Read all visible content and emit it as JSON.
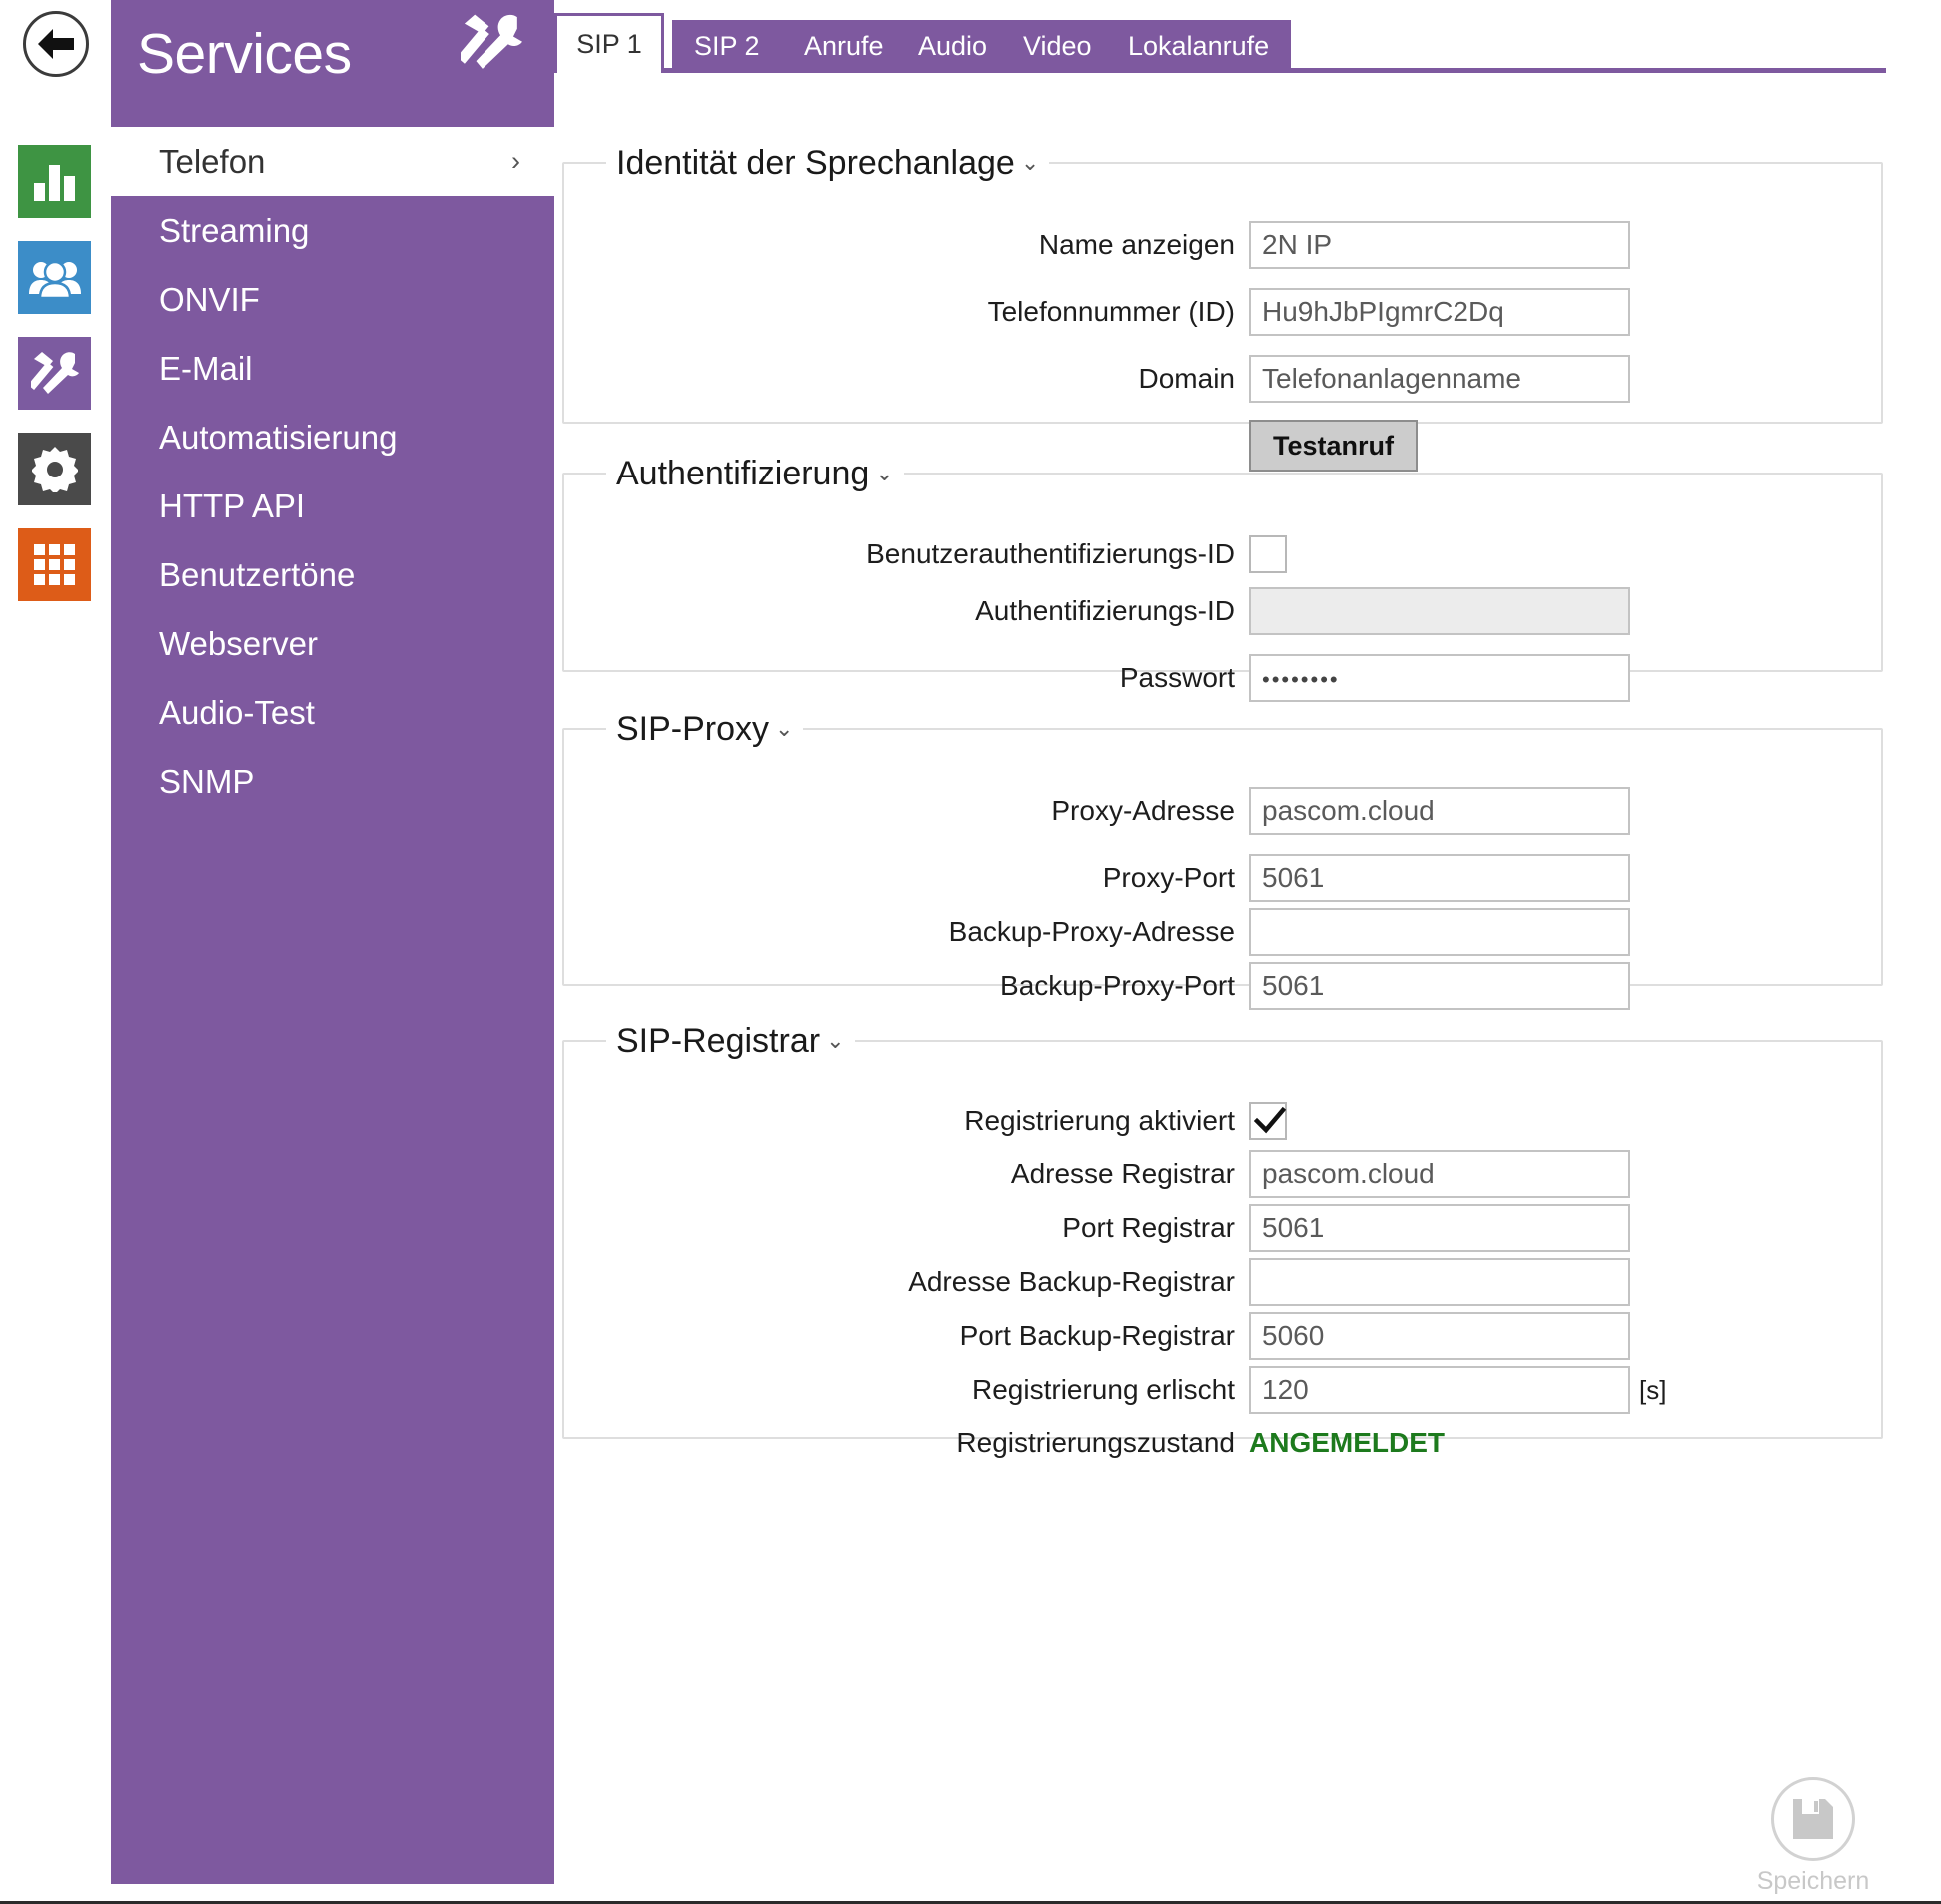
{
  "rail": {
    "back_button": "back-arrow-icon",
    "items": [
      {
        "name": "status-icon",
        "color": "#3e9443"
      },
      {
        "name": "directory-icon",
        "color": "#3c8dc8"
      },
      {
        "name": "services-icon",
        "color": "#7c5ba0"
      },
      {
        "name": "system-icon",
        "color": "#4a4a4a"
      },
      {
        "name": "apps-grid-icon",
        "color": "#dd5c18"
      }
    ]
  },
  "sidebar": {
    "title": "Services",
    "header_icon": "hammer-wrench-icon",
    "items": [
      {
        "label": "Telefon",
        "active": true,
        "chevron": "›"
      },
      {
        "label": "Streaming",
        "active": false
      },
      {
        "label": "ONVIF",
        "active": false
      },
      {
        "label": "E-Mail",
        "active": false
      },
      {
        "label": "Automatisierung",
        "active": false
      },
      {
        "label": "HTTP API",
        "active": false
      },
      {
        "label": "Benutzertöne",
        "active": false
      },
      {
        "label": "Webserver",
        "active": false
      },
      {
        "label": "Audio-Test",
        "active": false
      },
      {
        "label": "SNMP",
        "active": false
      }
    ]
  },
  "tabs": [
    {
      "label": "SIP 1",
      "active": true
    },
    {
      "label": "SIP 2",
      "active": false
    },
    {
      "label": "Anrufe",
      "active": false
    },
    {
      "label": "Audio",
      "active": false
    },
    {
      "label": "Video",
      "active": false
    },
    {
      "label": "Lokalanrufe",
      "active": false
    }
  ],
  "groups": {
    "identity": {
      "legend": "Identität der Sprechanlage",
      "caret": "⌄",
      "fields": [
        {
          "label": "Name anzeigen",
          "value": "2N IP"
        },
        {
          "label": "Telefonnummer (ID)",
          "value": "Hu9hJbPIgmrC2Dq"
        },
        {
          "label": "Domain",
          "value": "Telefonanlagenname"
        }
      ],
      "test_button": "Testanruf"
    },
    "auth": {
      "legend": "Authentifizierung",
      "caret": "⌄",
      "checkbox_label": "Benutzerauthentifizierungs-ID",
      "checkbox_checked": false,
      "fields": [
        {
          "label": "Authentifizierungs-ID",
          "value": "",
          "disabled": true
        },
        {
          "label": "Passwort",
          "value": "••••••••",
          "password": true
        }
      ]
    },
    "proxy": {
      "legend": "SIP-Proxy",
      "caret": "⌄",
      "fields": [
        {
          "label": "Proxy-Adresse",
          "value": "pascom.cloud"
        },
        {
          "label": "Proxy-Port",
          "value": "5061"
        },
        {
          "label": "Backup-Proxy-Adresse",
          "value": ""
        },
        {
          "label": "Backup-Proxy-Port",
          "value": "5061"
        }
      ]
    },
    "registrar": {
      "legend": "SIP-Registrar",
      "caret": "⌄",
      "checkbox_label": "Registrierung aktiviert",
      "checkbox_checked": true,
      "fields": [
        {
          "label": "Adresse Registrar",
          "value": "pascom.cloud"
        },
        {
          "label": "Port Registrar",
          "value": "5061"
        },
        {
          "label": "Adresse Backup-Registrar",
          "value": ""
        },
        {
          "label": "Port Backup-Registrar",
          "value": "5060"
        },
        {
          "label": "Registrierung erlischt",
          "value": "120",
          "unit": "[s]"
        }
      ],
      "status_label": "Registrierungszustand",
      "status_value": "ANGEMELDET",
      "status_color": "#1d7a1d"
    }
  },
  "save": {
    "label": "Speichern",
    "icon": "floppy-disk-icon"
  },
  "colors": {
    "purple": "#7e599f",
    "status_green": "#1d7a1d"
  }
}
